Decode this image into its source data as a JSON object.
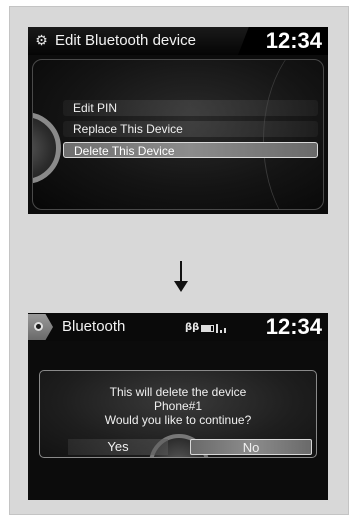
{
  "screen1": {
    "icon": "gear-icon",
    "title": "Edit Bluetooth device",
    "clock": "12:34",
    "menu": [
      {
        "label": "Edit PIN",
        "selected": false
      },
      {
        "label": "Replace This Device",
        "selected": false
      },
      {
        "label": "Delete This Device",
        "selected": true
      }
    ]
  },
  "arrow": {
    "icon": "arrow-down-icon"
  },
  "screen2": {
    "home_icon": "home-icon",
    "title": "Bluetooth",
    "status_icons": [
      "bluetooth-icon",
      "battery-icon",
      "signal-icon"
    ],
    "clock": "12:34",
    "dialog": {
      "line1": "This will delete the device",
      "line2": "Phone#1",
      "line3": "Would you like to continue?",
      "yes_label": "Yes",
      "no_label": "No",
      "selected": "No"
    }
  }
}
